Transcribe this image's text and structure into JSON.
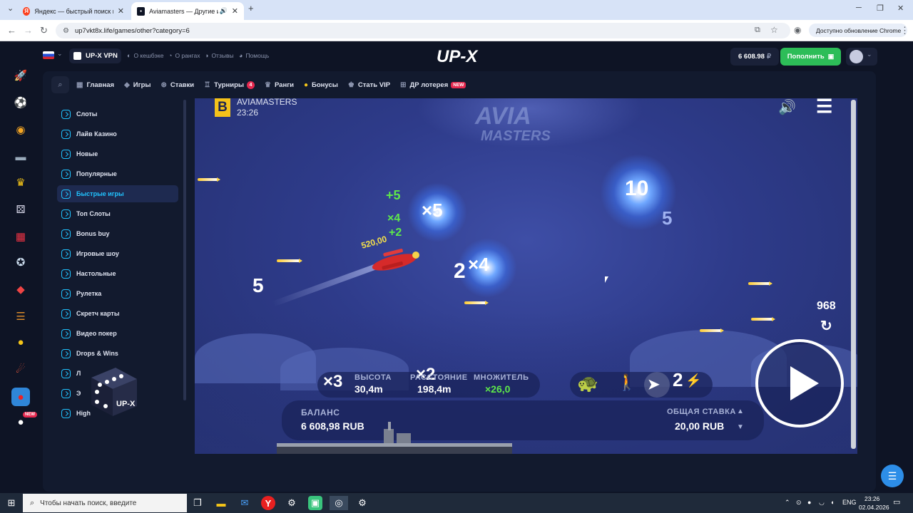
{
  "browser": {
    "tabs": [
      {
        "title": "Яндекс — быстрый поиск в ин",
        "active": false
      },
      {
        "title": "Aviamasters — Другие игр",
        "active": true
      }
    ],
    "new_tab": "+",
    "url": "up7vkt8x.life/games/other?category=6",
    "update_label": "Доступно обновление Chrome"
  },
  "header": {
    "vpn_label": "UP-X VPN",
    "links": [
      "О кешбэке",
      "О рангах",
      "Отзывы",
      "Помощь"
    ],
    "logo": "UP-X",
    "balance": "6 608.98",
    "currency": "₽",
    "topup_label": "Пополнить"
  },
  "nav": {
    "items": [
      {
        "label": "Главная",
        "icon": "grid-icon"
      },
      {
        "label": "Игры",
        "icon": "diamond-icon"
      },
      {
        "label": "Ставки",
        "icon": "ball-icon"
      },
      {
        "label": "Турниры",
        "icon": "cup-icon",
        "badge": "4"
      },
      {
        "label": "Ранги",
        "icon": "crown-icon"
      },
      {
        "label": "Бонусы",
        "icon": "coin-icon"
      },
      {
        "label": "Стать VIP",
        "icon": "crown-icon"
      },
      {
        "label": "ДР лотерея",
        "icon": "gift-icon",
        "tag": "NEW"
      }
    ]
  },
  "categories": {
    "items": [
      "Слоты",
      "Лайв Казино",
      "Новые",
      "Популярные",
      "Быстрые игры",
      "Топ Слоты",
      "Bonus buy",
      "Игровые шоу",
      "Настольные",
      "Рулетка",
      "Скретч карты",
      "Видео покер",
      "Drops & Wins",
      "Л",
      "Э",
      "High"
    ],
    "active_index": 4
  },
  "rail": {
    "icons": [
      "rocket-icon",
      "soccer-icon",
      "coin-icon",
      "chest-icon",
      "crown-icon",
      "dice-icon",
      "calendar-icon",
      "poker-chip-icon",
      "ticket-icon",
      "ladder-icon",
      "token-icon",
      "meteor-icon",
      "cherry-icon",
      "ball-new-icon"
    ],
    "new_tag": "NEW"
  },
  "dice_label": "UP-X",
  "game": {
    "provider_letter": "B",
    "title": "AVIAMASTERS",
    "time": "23:26",
    "logo_line1": "AVIA",
    "logo_line2": "MASTERS",
    "plane_amount": "520,00",
    "floating": [
      "+5",
      "×4",
      "+2",
      "×5",
      "10",
      "5",
      "2",
      "×4",
      "5"
    ],
    "distance_counter": "968",
    "hud": {
      "multiplier_badge_left": "×3",
      "multiplier_badge_mid": "×2",
      "height_label": "ВЫСОТА",
      "height_value": "30,4m",
      "distance_label": "РАССТОЯНИЕ",
      "distance_value": "198,4m",
      "multiplier_label": "МНОЖИТЕЛЬ",
      "multiplier_value": "×26,0",
      "speed_badge": "2"
    },
    "balance_label": "БАЛАНС",
    "balance_value": "6 608,98 RUB",
    "bet_label": "ОБЩАЯ СТАВКА",
    "bet_value": "20,00 RUB"
  },
  "taskbar": {
    "search_placeholder": "Чтобы начать поиск, введите",
    "lang": "ENG",
    "time": "23:26",
    "date": "02.04.2026"
  },
  "colors": {
    "accent": "#21c3ff",
    "topup": "#2dbd58",
    "badge": "#e5284f",
    "panel": "#121a2e",
    "page": "#0e1425"
  }
}
